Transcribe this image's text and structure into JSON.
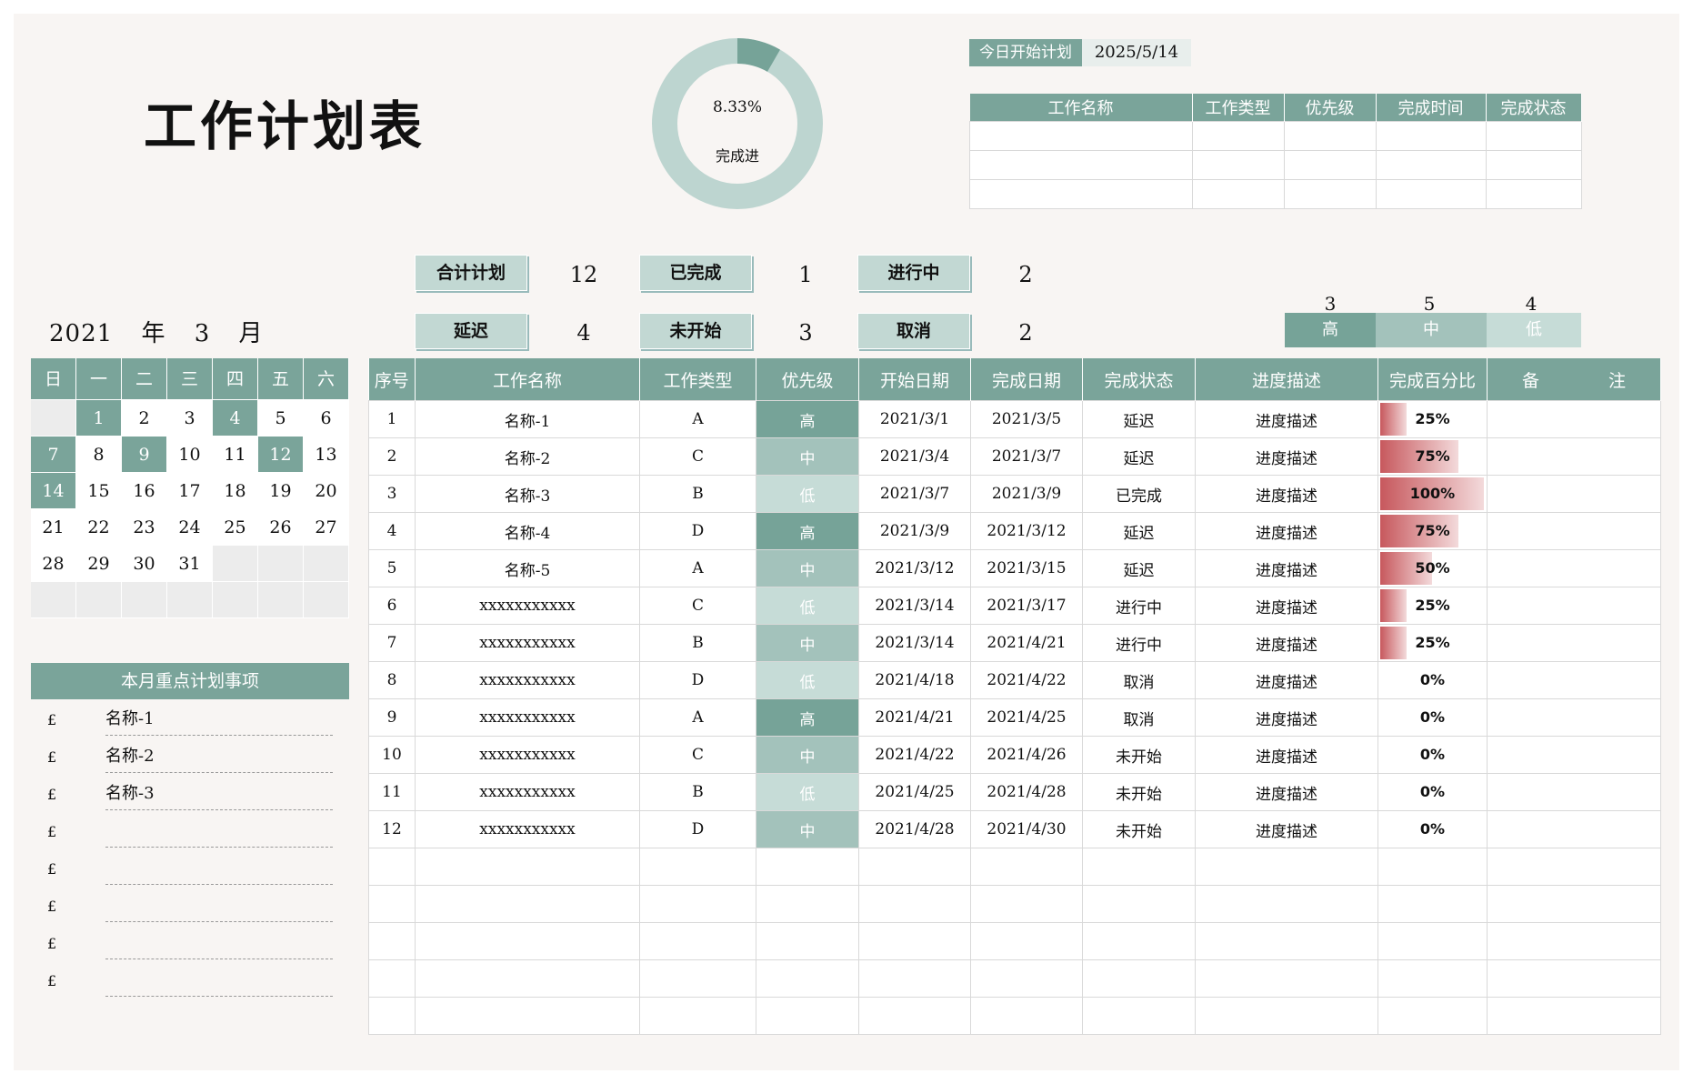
{
  "title": "工作计划表",
  "donut": {
    "percent_label": "8.33%",
    "label": "完成进",
    "fraction": 0.0833
  },
  "today": {
    "label": "今日开始计划",
    "date": "2025/5/14",
    "headers": [
      "工作名称",
      "工作类型",
      "优先级",
      "完成时间",
      "完成状态"
    ]
  },
  "stats": [
    {
      "label": "合计计划",
      "value": "12"
    },
    {
      "label": "已完成",
      "value": "1"
    },
    {
      "label": "进行中",
      "value": "2"
    },
    {
      "label": "延迟",
      "value": "4"
    },
    {
      "label": "未开始",
      "value": "3"
    },
    {
      "label": "取消",
      "value": "2"
    }
  ],
  "priority_counts": [
    {
      "label": "高",
      "count": "3",
      "color": "#76a398"
    },
    {
      "label": "中",
      "count": "5",
      "color": "#a3c2bb"
    },
    {
      "label": "低",
      "count": "4",
      "color": "#c6dcd7"
    }
  ],
  "calendar": {
    "year": "2021",
    "year_unit": "年",
    "month": "3",
    "month_unit": "月",
    "weekdays": [
      "日",
      "一",
      "二",
      "三",
      "四",
      "五",
      "六"
    ],
    "lead_blanks": 1,
    "days": 31,
    "highlighted": [
      1,
      4,
      7,
      9,
      12,
      14
    ]
  },
  "key_items": {
    "title": "本月重点计划事项",
    "checkbox": "£",
    "items": [
      "名称-1",
      "名称-2",
      "名称-3",
      "",
      "",
      "",
      "",
      ""
    ]
  },
  "table": {
    "headers": [
      "序号",
      "工作名称",
      "工作类型",
      "优先级",
      "开始日期",
      "完成日期",
      "完成状态",
      "进度描述",
      "完成百分比",
      "备　　　　注"
    ],
    "rows": [
      {
        "no": "1",
        "name": "名称-1",
        "type": "A",
        "priority": "高",
        "start": "2021/3/1",
        "end": "2021/3/5",
        "status": "延迟",
        "desc": "进度描述",
        "pct": "25%",
        "pct_value": 0.25,
        "note": ""
      },
      {
        "no": "2",
        "name": "名称-2",
        "type": "C",
        "priority": "中",
        "start": "2021/3/4",
        "end": "2021/3/7",
        "status": "延迟",
        "desc": "进度描述",
        "pct": "75%",
        "pct_value": 0.75,
        "note": ""
      },
      {
        "no": "3",
        "name": "名称-3",
        "type": "B",
        "priority": "低",
        "start": "2021/3/7",
        "end": "2021/3/9",
        "status": "已完成",
        "desc": "进度描述",
        "pct": "100%",
        "pct_value": 1.0,
        "note": ""
      },
      {
        "no": "4",
        "name": "名称-4",
        "type": "D",
        "priority": "高",
        "start": "2021/3/9",
        "end": "2021/3/12",
        "status": "延迟",
        "desc": "进度描述",
        "pct": "75%",
        "pct_value": 0.75,
        "note": ""
      },
      {
        "no": "5",
        "name": "名称-5",
        "type": "A",
        "priority": "中",
        "start": "2021/3/12",
        "end": "2021/3/15",
        "status": "延迟",
        "desc": "进度描述",
        "pct": "50%",
        "pct_value": 0.5,
        "note": ""
      },
      {
        "no": "6",
        "name": "xxxxxxxxxxx",
        "type": "C",
        "priority": "低",
        "start": "2021/3/14",
        "end": "2021/3/17",
        "status": "进行中",
        "desc": "进度描述",
        "pct": "25%",
        "pct_value": 0.25,
        "note": ""
      },
      {
        "no": "7",
        "name": "xxxxxxxxxxx",
        "type": "B",
        "priority": "中",
        "start": "2021/3/14",
        "end": "2021/4/21",
        "status": "进行中",
        "desc": "进度描述",
        "pct": "25%",
        "pct_value": 0.25,
        "note": ""
      },
      {
        "no": "8",
        "name": "xxxxxxxxxxx",
        "type": "D",
        "priority": "低",
        "start": "2021/4/18",
        "end": "2021/4/22",
        "status": "取消",
        "desc": "进度描述",
        "pct": "0%",
        "pct_value": 0,
        "note": ""
      },
      {
        "no": "9",
        "name": "xxxxxxxxxxx",
        "type": "A",
        "priority": "高",
        "start": "2021/4/21",
        "end": "2021/4/25",
        "status": "取消",
        "desc": "进度描述",
        "pct": "0%",
        "pct_value": 0,
        "note": ""
      },
      {
        "no": "10",
        "name": "xxxxxxxxxxx",
        "type": "C",
        "priority": "中",
        "start": "2021/4/22",
        "end": "2021/4/26",
        "status": "未开始",
        "desc": "进度描述",
        "pct": "0%",
        "pct_value": 0,
        "note": ""
      },
      {
        "no": "11",
        "name": "xxxxxxxxxxx",
        "type": "B",
        "priority": "低",
        "start": "2021/4/25",
        "end": "2021/4/28",
        "status": "未开始",
        "desc": "进度描述",
        "pct": "0%",
        "pct_value": 0,
        "note": ""
      },
      {
        "no": "12",
        "name": "xxxxxxxxxxx",
        "type": "D",
        "priority": "中",
        "start": "2021/4/28",
        "end": "2021/4/30",
        "status": "未开始",
        "desc": "进度描述",
        "pct": "0%",
        "pct_value": 0,
        "note": ""
      }
    ],
    "blank_rows": 5
  }
}
